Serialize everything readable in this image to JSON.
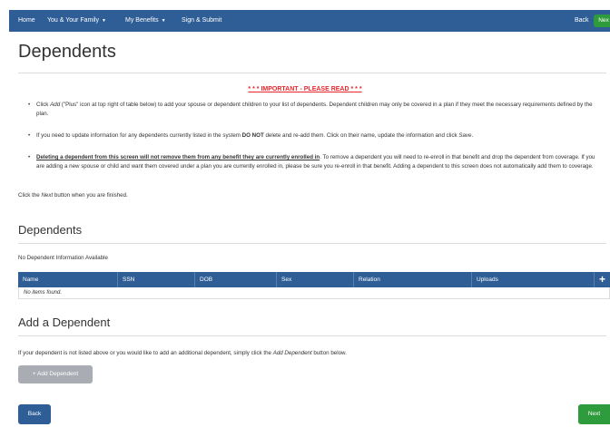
{
  "nav": {
    "home": "Home",
    "family": "You & Your Family",
    "benefits": "My Benefits",
    "sign": "Sign & Submit",
    "back": "Back",
    "next": "Nex"
  },
  "page_title": "Dependents",
  "important": {
    "prefix": "* * * ",
    "text": "IMPORTANT - PLEASE READ",
    "suffix": " * * *"
  },
  "bullets": [
    {
      "a": "Click ",
      "b": "Add",
      "c": " (\"Plus\" icon at top right of table below) to add your spouse or dependent children to your list of dependents. Dependent children may only be covered in a plan if they meet the necessary requirements defined by the plan."
    },
    {
      "a": "If you need to update information for any dependents currently listed in the system ",
      "b": "DO NOT",
      "c": " delete and re-add them. Click on their name, update the information and click ",
      "d": "Save",
      "e": "."
    },
    {
      "a": "Deleting a dependent from this screen will not remove them from any benefit they are currently enrolled in",
      "b": ". To remove a dependent you will need to re-enroll in that benefit and drop the dependent from coverage. If you are adding a new spouse or child and want them covered under a plan you are currently enrolled in, please be sure you re-enroll in that benefit. Adding a dependent to this screen does not automatically add them to coverage."
    }
  ],
  "finish": {
    "a": "Click the ",
    "b": "Next",
    "c": " button when you are finished."
  },
  "dependents_section": {
    "title": "Dependents",
    "no_info": "No Dependent Information Available"
  },
  "table": {
    "headers": [
      "Name",
      "SSN",
      "DOB",
      "Sex",
      "Relation",
      "Uploads"
    ],
    "add_symbol": "+",
    "empty": "No items found."
  },
  "add_section": {
    "title": "Add a Dependent",
    "text_a": "If your dependent is not listed above or you would like to add an additional dependent, simply click the ",
    "text_b": "Add Dependent",
    "text_c": " button below.",
    "button": "+ Add Dependent"
  },
  "footer": {
    "back": "Back",
    "next": "Next"
  },
  "colors": {
    "nav": "#2f5e96",
    "next_button": "#2e9b3c",
    "important": "#e8252b",
    "disabled_button": "#a9adb3"
  }
}
